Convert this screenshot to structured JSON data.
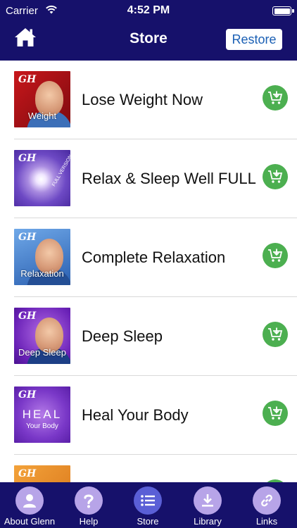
{
  "status_bar": {
    "carrier": "Carrier",
    "time": "4:52 PM"
  },
  "nav": {
    "title": "Store",
    "restore_label": "Restore"
  },
  "colors": {
    "nav_bg": "#16116b",
    "buy_button": "#4caf50",
    "tab_circle": "#b7a4e8",
    "tab_circle_active": "#5a5fd6"
  },
  "items": [
    {
      "title": "Lose Weight Now",
      "thumb_label": "Weight",
      "thumb_badge": "GH"
    },
    {
      "title": "Relax & Sleep Well FULL",
      "thumb_label": "",
      "thumb_badge": "GH",
      "thumb_ribbon": "FULL VERSION"
    },
    {
      "title": "Complete Relaxation",
      "thumb_label": "Relaxation",
      "thumb_badge": "GH"
    },
    {
      "title": "Deep Sleep",
      "thumb_label": "Deep Sleep",
      "thumb_badge": "GH"
    },
    {
      "title": "Heal Your Body",
      "thumb_label": "HEAL",
      "thumb_sublabel": "Your Body",
      "thumb_badge": "GH"
    },
    {
      "title": "",
      "thumb_label": "",
      "thumb_badge": "GH"
    }
  ],
  "tabs": [
    {
      "label": "About Glenn",
      "icon": "person-icon"
    },
    {
      "label": "Help",
      "icon": "question-icon"
    },
    {
      "label": "Store",
      "icon": "list-icon",
      "active": true
    },
    {
      "label": "Library",
      "icon": "download-icon"
    },
    {
      "label": "Links",
      "icon": "link-icon"
    }
  ]
}
